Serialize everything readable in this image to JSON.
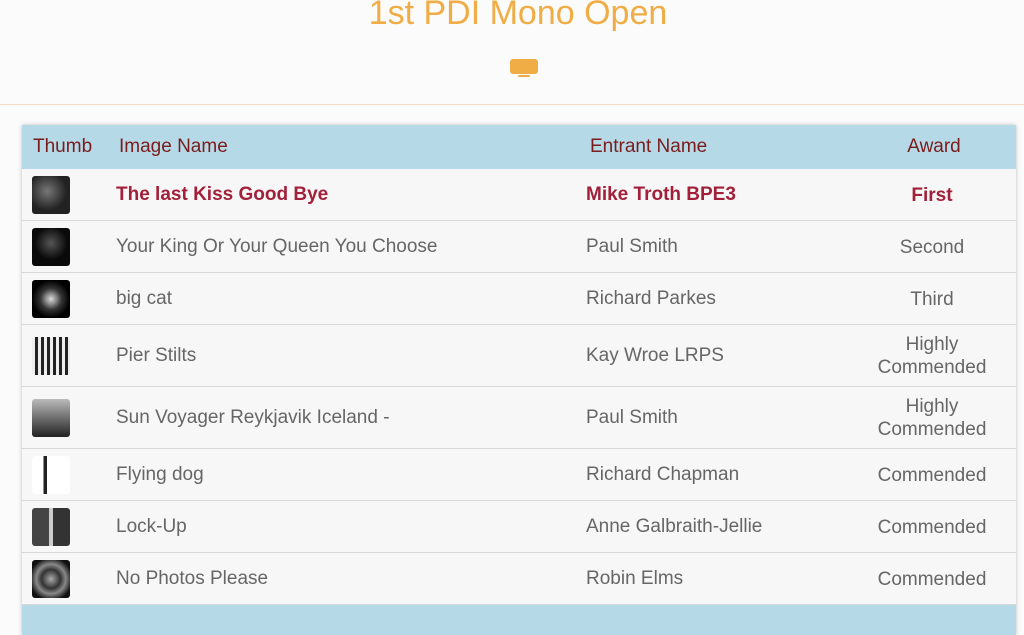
{
  "header": {
    "title": "1st PDI Mono Open",
    "slideshow_icon": "monitor-icon",
    "accent_color": "#f0ad45"
  },
  "table": {
    "columns": {
      "thumb": "Thumb",
      "image_name": "Image Name",
      "entrant_name": "Entrant Name",
      "award": "Award"
    },
    "rows": [
      {
        "image_name": "The last Kiss Good Bye",
        "entrant": "Mike Troth BPE3",
        "award": "First",
        "highlight": true
      },
      {
        "image_name": "Your King Or Your Queen You Choose",
        "entrant": "Paul Smith",
        "award": "Second"
      },
      {
        "image_name": "big cat",
        "entrant": "Richard Parkes",
        "award": "Third"
      },
      {
        "image_name": "Pier Stilts",
        "entrant": "Kay Wroe LRPS",
        "award": "Highly Commended"
      },
      {
        "image_name": "Sun Voyager Reykjavik Iceland -",
        "entrant": "Paul Smith",
        "award": "Highly Commended"
      },
      {
        "image_name": "Flying dog",
        "entrant": "Richard Chapman",
        "award": "Commended"
      },
      {
        "image_name": "Lock-Up",
        "entrant": "Anne Galbraith-Jellie",
        "award": "Commended"
      },
      {
        "image_name": "No Photos Please",
        "entrant": "Robin Elms",
        "award": "Commended"
      }
    ]
  }
}
